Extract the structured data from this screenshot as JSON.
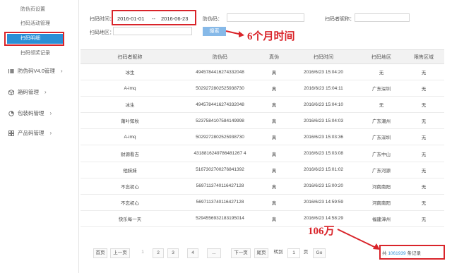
{
  "sidebar": {
    "sub_items": [
      "防伪页设置",
      "扫码活动管理",
      "扫码明细",
      "扫码领奖记录"
    ],
    "menus": [
      {
        "label": "防伪码V4.0管理",
        "icon": "barcode-icon"
      },
      {
        "label": "箱码管理",
        "icon": "box-icon"
      },
      {
        "label": "包装码管理",
        "icon": "package-icon"
      },
      {
        "label": "产品码管理",
        "icon": "grid-icon"
      }
    ]
  },
  "filters": {
    "scan_time_label": "扫码时间：",
    "date_from": "2016-01-01",
    "date_sep": "--",
    "date_to": "2016-06-23",
    "code_label": "防伪码：",
    "nickname_label": "扫码者昵称：",
    "region_label": "扫码地区：",
    "query_button": "搜索"
  },
  "annotations": {
    "months": "6个月时间",
    "total": "106万"
  },
  "table": {
    "headers": [
      "扫码者昵称",
      "防伪码",
      "真伪",
      "扫码时间",
      "扫码地区",
      "限售区域"
    ],
    "rows": [
      [
        "冰生",
        "4945784416274332048",
        "真",
        "2016/6/23 15:04:20",
        "无",
        "无"
      ],
      [
        "A-imq",
        "5029272802525938730",
        "真",
        "2016/6/23 15:04:11",
        "广东深圳",
        "无"
      ],
      [
        "冰生",
        "4945784416274332048",
        "真",
        "2016/6/23 15:04:10",
        "无",
        "无"
      ],
      [
        "莆叶知秋",
        "5237584107584149998",
        "真",
        "2016/6/23 15:04:03",
        "广东潮州",
        "无"
      ],
      [
        "A-imq",
        "5029272802525938730",
        "真",
        "2016/6/23 15:03:36",
        "广东深圳",
        "无"
      ],
      [
        "财源看吉",
        "4318816249786481267 4",
        "真",
        "2016/6/23 15:03:08",
        "广东中山",
        "无"
      ],
      [
        "他妹妹",
        "5167302700276841392",
        "真",
        "2016/6/23 15:01:02",
        "广东河源",
        "无"
      ],
      [
        "不忘初心",
        "5697113740116427128",
        "真",
        "2016/6/23 15:00:20",
        "河南南阳",
        "无"
      ],
      [
        "不忘初心",
        "5697113740116427128",
        "真",
        "2016/6/23 14:59:59",
        "河南南阳",
        "无"
      ],
      [
        "快乐每一天",
        "5294556932183195014",
        "真",
        "2016/6/23 14:58:29",
        "福建漳州",
        "无"
      ]
    ]
  },
  "pagination": {
    "first": "首页",
    "prev": "上一页",
    "pages": [
      "1",
      "2",
      "3",
      "4"
    ],
    "ellipsis": "...",
    "next": "下一页",
    "last": "尾页",
    "goto_label": "转到",
    "goto_value": "1",
    "page_unit": "页",
    "go": "Go",
    "total_prefix": "共",
    "total_count": "1061939",
    "total_suffix": "条记录"
  },
  "colors": {
    "accent": "#2a8fd6",
    "annotation": "#d9242a"
  }
}
